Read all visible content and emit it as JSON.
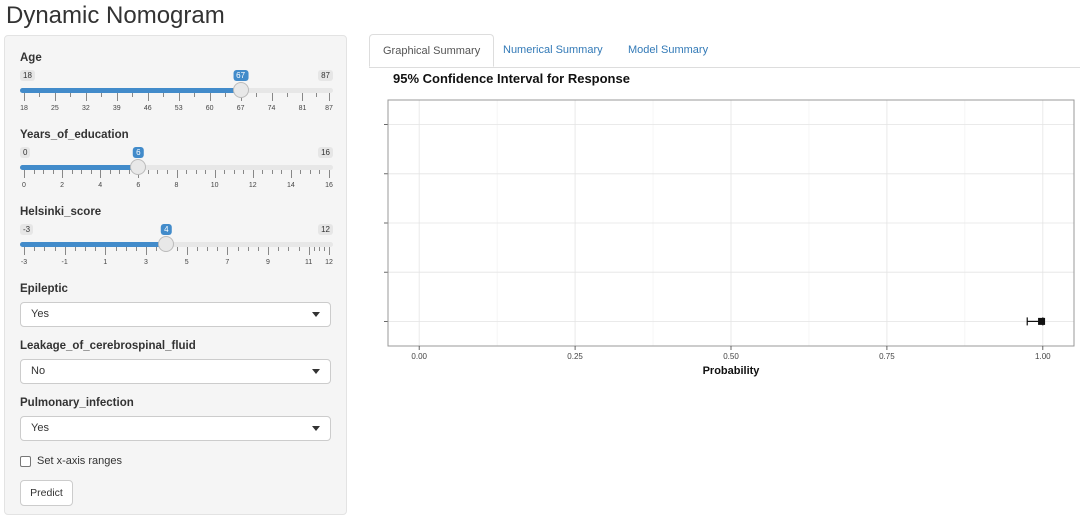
{
  "app": {
    "title": "Dynamic Nomogram"
  },
  "sidebar": {
    "sliders": [
      {
        "label": "Age",
        "min": 18,
        "max": 87,
        "value": 67,
        "min_label": "18",
        "max_label": "87",
        "value_label": "67",
        "ticks": [
          "18",
          "25",
          "32",
          "39",
          "46",
          "53",
          "60",
          "67",
          "74",
          "81",
          "87"
        ],
        "minor_per_major": 2
      },
      {
        "label": "Years_of_education",
        "min": 0,
        "max": 16,
        "value": 6,
        "min_label": "0",
        "max_label": "16",
        "value_label": "6",
        "ticks": [
          "0",
          "2",
          "4",
          "6",
          "8",
          "10",
          "12",
          "14",
          "16"
        ],
        "minor_per_major": 4
      },
      {
        "label": "Helsinki_score",
        "min": -3,
        "max": 12,
        "value": 4,
        "min_label": "-3",
        "max_label": "12",
        "value_label": "4",
        "ticks": [
          "-3",
          "-1",
          "1",
          "3",
          "5",
          "7",
          "9",
          "11",
          "12"
        ],
        "minor_per_major": 4
      }
    ],
    "selects": [
      {
        "label": "Epileptic",
        "value": "Yes"
      },
      {
        "label": "Leakage_of_cerebrospinal_fluid",
        "value": "No"
      },
      {
        "label": "Pulmonary_infection",
        "value": "Yes"
      }
    ],
    "xrange_checkbox": {
      "label": "Set x-axis ranges",
      "checked": false
    },
    "predict_label": "Predict"
  },
  "tabs": [
    {
      "label": "Graphical Summary",
      "active": true
    },
    {
      "label": "Numerical Summary",
      "active": false
    },
    {
      "label": "Model Summary",
      "active": false
    }
  ],
  "chart_data": {
    "type": "scatter",
    "title": "95% Confidence Interval for Response",
    "xlabel": "Probability",
    "ylabel": "",
    "xlim": [
      -0.05,
      1.05
    ],
    "xticks": [
      0.0,
      0.25,
      0.5,
      0.75,
      1.0
    ],
    "xtick_labels": [
      "0.00",
      "0.25",
      "0.50",
      "0.75",
      "1.00"
    ],
    "y_levels": 5,
    "grid": true,
    "points": [
      {
        "x": 0.998,
        "lower": 0.975,
        "upper": 1.0,
        "y_level": 1
      }
    ]
  }
}
